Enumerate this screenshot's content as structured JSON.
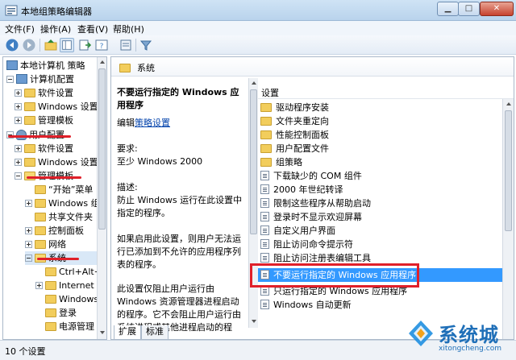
{
  "window": {
    "title": "本地组策略编辑器"
  },
  "menu": {
    "items": [
      "文件(F)",
      "操作(A)",
      "查看(V)",
      "帮助(H)"
    ]
  },
  "tree": {
    "items": [
      {
        "label": "本地计算机 策略",
        "icon": "computer-policy-icon"
      },
      {
        "label": "计算机配置",
        "icon": "computer-icon"
      },
      {
        "label": "软件设置",
        "icon": "folder-icon"
      },
      {
        "label": "Windows 设置",
        "icon": "folder-icon"
      },
      {
        "label": "管理模板",
        "icon": "folder-icon"
      },
      {
        "label": "用户配置",
        "icon": "user-icon"
      },
      {
        "label": "软件设置",
        "icon": "folder-icon"
      },
      {
        "label": "Windows 设置",
        "icon": "folder-icon"
      },
      {
        "label": "管理模板",
        "icon": "folder-icon"
      },
      {
        "label": "“开始”菜单",
        "icon": "folder-icon"
      },
      {
        "label": "Windows 组件",
        "icon": "folder-icon"
      },
      {
        "label": "共享文件夹",
        "icon": "folder-icon"
      },
      {
        "label": "控制面板",
        "icon": "folder-icon"
      },
      {
        "label": "网络",
        "icon": "folder-icon"
      },
      {
        "label": "系统",
        "icon": "folder-icon"
      },
      {
        "label": "Ctrl+Alt+Del",
        "icon": "folder-icon"
      },
      {
        "label": "Internet",
        "icon": "folder-icon"
      },
      {
        "label": "Windows",
        "icon": "folder-icon"
      },
      {
        "label": "登录",
        "icon": "folder-icon"
      },
      {
        "label": "电源管理",
        "icon": "folder-icon"
      }
    ]
  },
  "pane": {
    "header": "系统",
    "description": {
      "title": "不要运行指定的 Windows 应用程序",
      "edit_prefix": "编辑",
      "edit_link": "策略设置",
      "requirement_label": "要求:",
      "requirement_value": "至少 Windows 2000",
      "desc_label": "描述:",
      "desc_text": "防止 Windows 运行在此设置中指定的程序。",
      "para2": "如果启用此设置，则用户无法运行已添加到不允许的应用程序列表的程序。",
      "para3": "此设置仅阻止用户运行由 Windows 资源管理器进程启动的程序。它不会阻止用户运行由系统进程或其他进程启动的程序，如任"
    },
    "list_header": "设置",
    "list": [
      {
        "label": "驱动程序安装",
        "kind": "folder"
      },
      {
        "label": "文件夹重定向",
        "kind": "folder"
      },
      {
        "label": "性能控制面板",
        "kind": "folder"
      },
      {
        "label": "用户配置文件",
        "kind": "folder"
      },
      {
        "label": "组策略",
        "kind": "folder"
      },
      {
        "label": "下载缺少的 COM 组件",
        "kind": "setting"
      },
      {
        "label": "2000 年世纪转译",
        "kind": "setting"
      },
      {
        "label": "限制这些程序从帮助启动",
        "kind": "setting"
      },
      {
        "label": "登录时不显示欢迎屏幕",
        "kind": "setting"
      },
      {
        "label": "自定义用户界面",
        "kind": "setting"
      },
      {
        "label": "阻止访问命令提示符",
        "kind": "setting"
      },
      {
        "label": "阻止访问注册表编辑工具",
        "kind": "setting"
      },
      {
        "label": "不要运行指定的 Windows 应用程序",
        "kind": "setting"
      },
      {
        "label": "只运行指定的 Windows 应用程序",
        "kind": "setting"
      },
      {
        "label": "Windows 自动更新",
        "kind": "setting"
      }
    ],
    "selected_index": 12
  },
  "tabs": [
    "扩展",
    "标准"
  ],
  "status": {
    "text": "10 个设置"
  },
  "watermark": {
    "text": "系统城",
    "url": "xitongcheng.com"
  },
  "colors": {
    "selection": "#3399ff",
    "annotation": "#e0202a"
  }
}
